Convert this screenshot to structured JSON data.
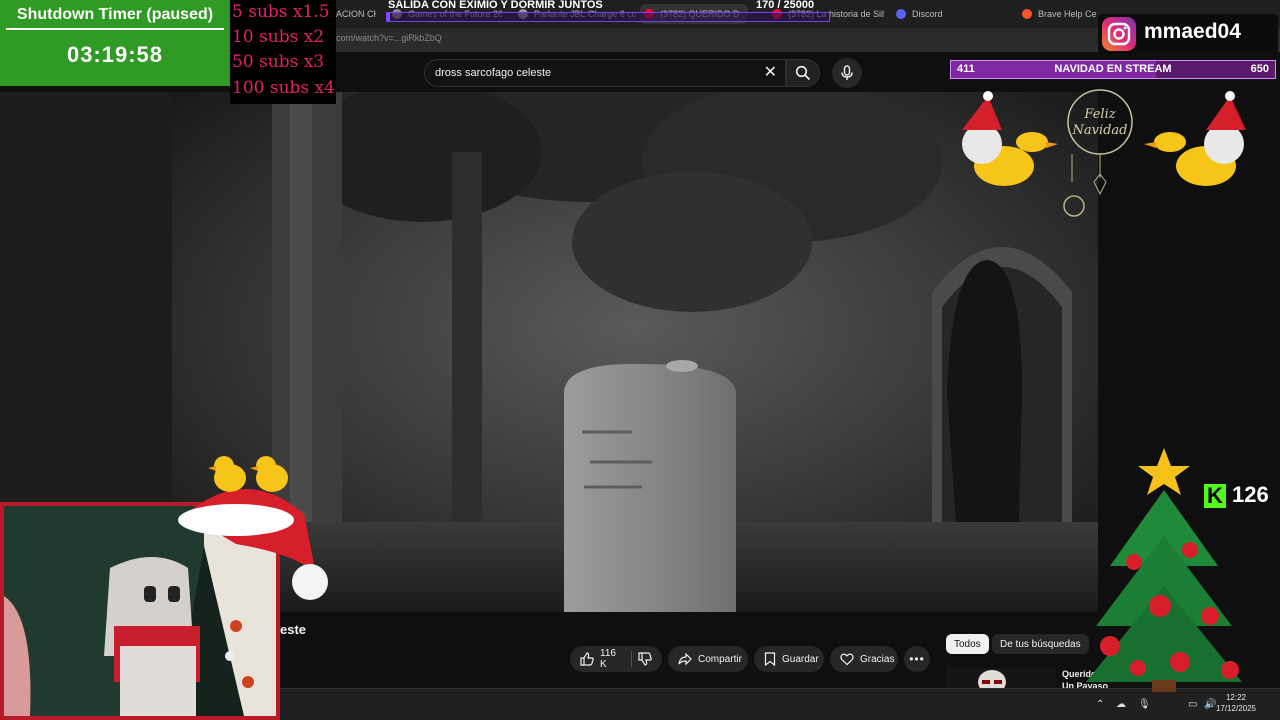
{
  "browser": {
    "tabs": [
      "ACION CH",
      "Games of the Future 2025",
      "Parlante JBL Charge 6 colo",
      "(3782) QUERIDO D",
      "(3782) La historia de Silk F",
      "Discord",
      "Brave Help Cent"
    ],
    "url": "com/watch?v=...giRkbZbQ"
  },
  "youtube": {
    "search_value": "dross sarcofago celeste",
    "video_title_fragment": "este",
    "likes": "116 K",
    "share_label": "Compartir",
    "save_label": "Guardar",
    "thanks_label": "Gracias",
    "chips": [
      "Todos",
      "De tus búsquedas"
    ],
    "rec_title": "Querido Dross: Un Payaso"
  },
  "overlays": {
    "timer_title": "Shutdown Timer (paused)",
    "timer_value": "03:19:58",
    "subs_multipliers": [
      "5 subs x1.5",
      "10 subs x2",
      "50 subs x3",
      "100 subs x4"
    ],
    "goal_text": "SALIDA CON EXIMIO Y DORMIR JUNTOS",
    "goal_count": "170 / 25000",
    "goal_progress": 0.0068,
    "instagram_handle": "mmaed04",
    "xmas_left": "411",
    "xmas_center": "NAVIDAD EN STREAM",
    "xmas_right": "650",
    "xmas_progress": 0.632,
    "kick_viewers": "126"
  },
  "taskbar": {
    "time": "12:22",
    "date": "17/12/2025"
  },
  "colors": {
    "timer_bg": "#2f9a24",
    "subs_text": "#e3206a",
    "kick_green": "#53fc18",
    "goal_purple": "#8f4dff"
  }
}
